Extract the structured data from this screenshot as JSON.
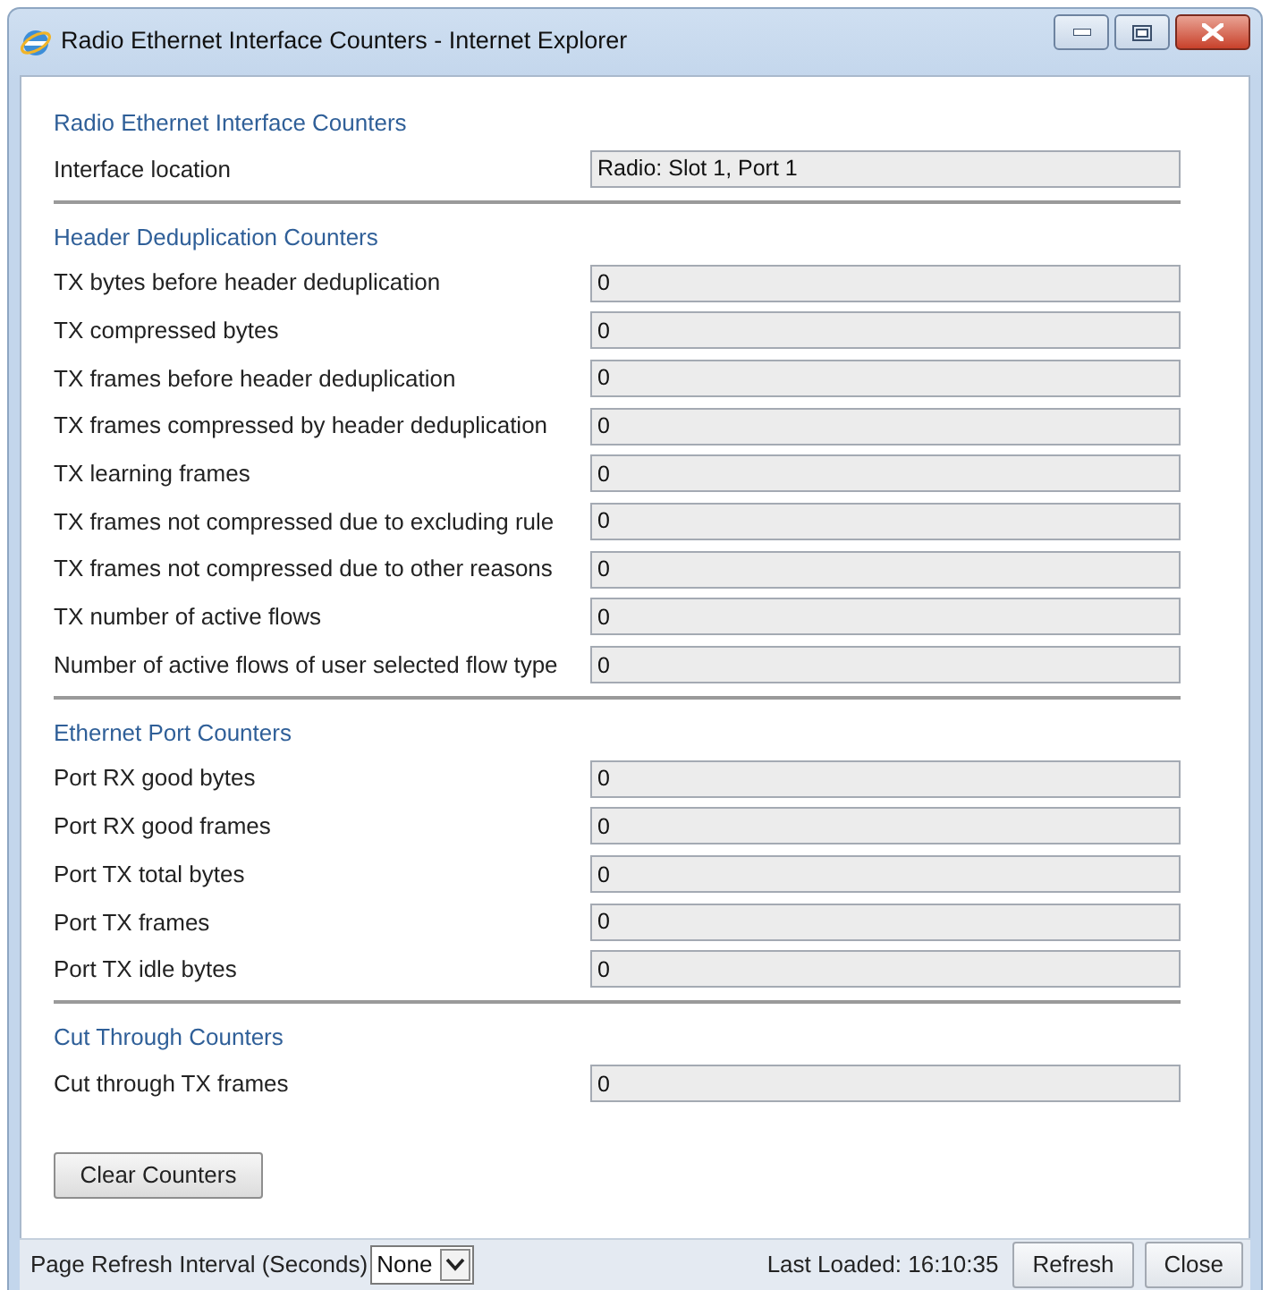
{
  "window": {
    "title": "Radio Ethernet Interface Counters - Internet Explorer"
  },
  "sections": [
    {
      "heading": "Radio Ethernet Interface Counters",
      "rows": [
        {
          "label": "Interface location",
          "value": "Radio: Slot 1, Port 1"
        }
      ]
    },
    {
      "heading": "Header Deduplication Counters",
      "rows": [
        {
          "label": "TX bytes before header deduplication",
          "value": "0"
        },
        {
          "label": "TX compressed bytes",
          "value": "0"
        },
        {
          "label": "TX frames before header deduplication",
          "value": "0"
        },
        {
          "label": "TX frames compressed by header deduplication",
          "value": "0"
        },
        {
          "label": "TX learning frames",
          "value": "0"
        },
        {
          "label": "TX frames not compressed due to excluding rule",
          "value": "0"
        },
        {
          "label": "TX frames not compressed due to other reasons",
          "value": "0"
        },
        {
          "label": "TX number of active flows",
          "value": "0"
        },
        {
          "label": "Number of active flows of user selected flow type",
          "value": "0"
        }
      ]
    },
    {
      "heading": "Ethernet Port Counters",
      "rows": [
        {
          "label": "Port RX good bytes",
          "value": "0"
        },
        {
          "label": "Port RX good frames",
          "value": "0"
        },
        {
          "label": "Port TX total bytes",
          "value": "0"
        },
        {
          "label": "Port TX frames",
          "value": "0"
        },
        {
          "label": "Port TX idle bytes",
          "value": "0"
        }
      ]
    },
    {
      "heading": "Cut Through Counters",
      "rows": [
        {
          "label": "Cut through TX frames",
          "value": "0"
        }
      ]
    }
  ],
  "clear_button": "Clear Counters",
  "status_bar": {
    "refresh_label": "Page Refresh Interval (Seconds)",
    "refresh_select": "None",
    "last_loaded": "Last Loaded: 16:10:35",
    "buttons": [
      "Refresh",
      "Close"
    ]
  }
}
